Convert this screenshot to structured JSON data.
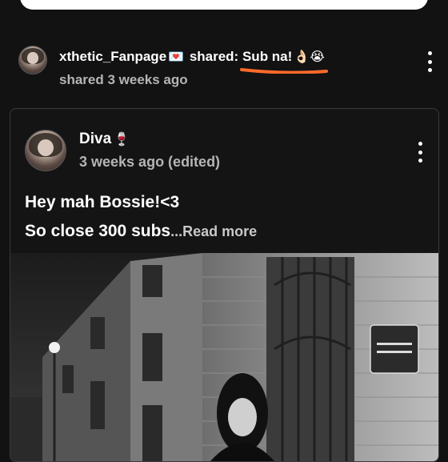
{
  "share": {
    "username": "xthetic_Fanpage",
    "username_emoji": "💌",
    "action": "shared:",
    "message": "Sub na!",
    "message_emojis": "👌🏻😭",
    "time": "shared 3 weeks ago"
  },
  "post": {
    "author": "Diva",
    "author_emoji": "🍷",
    "time": "3 weeks ago (edited)",
    "line1": "Hey mah Bossie!<3",
    "line2": "So close 300 subs",
    "read_more": "...Read more"
  },
  "colors": {
    "background": "#121212",
    "underline_accent": "#ff6a2b",
    "secondary_text": "#b5b5b5"
  },
  "icons": [
    "more-vert-icon"
  ]
}
